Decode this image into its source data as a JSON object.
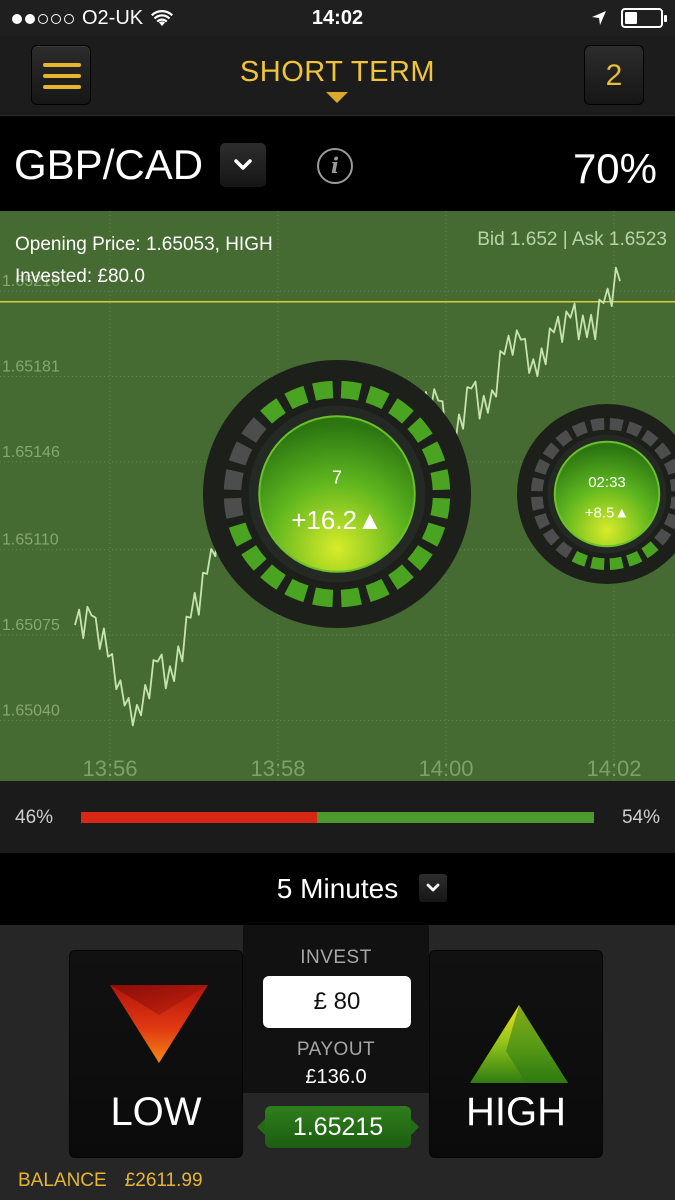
{
  "status_bar": {
    "carrier": "O2-UK",
    "time": "14:02",
    "signal_bars": 2,
    "signal_total": 5,
    "battery_level": 0.35
  },
  "header": {
    "title": "SHORT TERM",
    "count": "2"
  },
  "asset": {
    "pair": "GBP/CAD",
    "payout_percent": "70%",
    "info_icon": "i"
  },
  "chart": {
    "opening_line": "Opening Price: 1.65053, HIGH",
    "invested_line": "Invested: £80.0",
    "bid_ask": "Bid 1.652 | Ask 1.6523",
    "colors": {
      "background": "#456b32",
      "line": "#c7e3b0",
      "open_line": "#d8cf3a"
    }
  },
  "chart_data": {
    "type": "line",
    "y_ticks": [
      "1.65216",
      "1.65181",
      "1.65146",
      "1.65110",
      "1.65075",
      "1.65040"
    ],
    "x_ticks": [
      "13:56",
      "13:58",
      "14:00",
      "14:02"
    ],
    "ylim": [
      1.65025,
      1.6523
    ],
    "opening_price": 1.6521,
    "series": [
      {
        "x": [
          0.0,
          0.25,
          0.5,
          0.75,
          1.0,
          1.25,
          1.5,
          1.75,
          2.0,
          2.25,
          2.5,
          2.75,
          3.0,
          3.25,
          3.5,
          3.75,
          4.0,
          4.25,
          4.5,
          4.75,
          5.0,
          5.25,
          5.5,
          5.75,
          6.0,
          6.25,
          6.5,
          6.75,
          7.0,
          7.25,
          7.5,
          7.75,
          8.0,
          8.25
        ],
        "values": [
          1.65075,
          1.65079,
          1.65062,
          1.65042,
          1.65038,
          1.6506,
          1.65052,
          1.65078,
          1.65096,
          1.65122,
          1.65108,
          1.65092,
          1.65098,
          1.65084,
          1.65106,
          1.65125,
          1.65116,
          1.65141,
          1.65136,
          1.65152,
          1.65149,
          1.65163,
          1.65167,
          1.65148,
          1.65172,
          1.65162,
          1.65186,
          1.65192,
          1.65177,
          1.65195,
          1.65201,
          1.65193,
          1.65207,
          1.65216
        ]
      }
    ]
  },
  "open_trades": [
    {
      "label": "7",
      "value": "+16.2",
      "arrow": "▲"
    },
    {
      "label": "02:33",
      "value": "+8.5",
      "arrow": "▲"
    }
  ],
  "sentiment": {
    "low_percent": "46%",
    "high_percent": "54%",
    "low_fraction": 0.46,
    "low_color": "#d82714",
    "high_color": "#4c9a2e"
  },
  "expiry": {
    "label": "5 Minutes"
  },
  "trade": {
    "low_label": "LOW",
    "high_label": "HIGH",
    "invest_label": "INVEST",
    "invest_value": "£ 80",
    "payout_label": "PAYOUT",
    "payout_value": "£136.0",
    "current_price": "1.65215"
  },
  "balance": {
    "label": "BALANCE",
    "value": "£2611.99"
  }
}
